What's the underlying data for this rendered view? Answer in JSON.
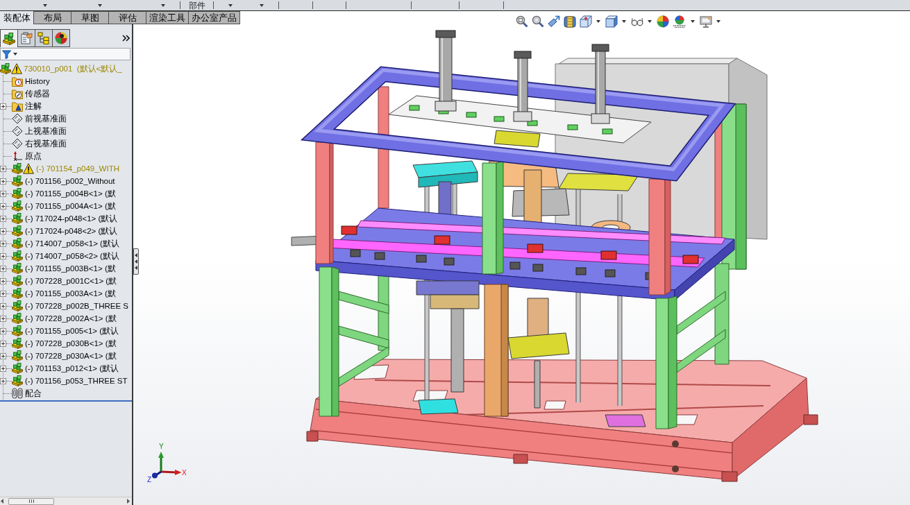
{
  "ribbon": {
    "group_label": "部件"
  },
  "command_tabs": [
    {
      "label": "装配体",
      "selected": true
    },
    {
      "label": "布局",
      "selected": false
    },
    {
      "label": "草图",
      "selected": false
    },
    {
      "label": "评估",
      "selected": false
    },
    {
      "label": "渲染工具",
      "selected": false
    },
    {
      "label": "办公室产品",
      "selected": false
    }
  ],
  "panel_tabs": [
    {
      "kind": "feature-tree",
      "selected": true
    },
    {
      "kind": "property-manager",
      "selected": false
    },
    {
      "kind": "configuration-manager",
      "selected": false
    },
    {
      "kind": "display-manager",
      "selected": false
    }
  ],
  "feature_tree": [
    {
      "label": "730010_p001  (默认<默认_",
      "kind": "assembly",
      "warning": true,
      "children": [
        {
          "label": "History",
          "kind": "history",
          "warning": false
        },
        {
          "label": "传感器",
          "kind": "sensors",
          "warning": false
        },
        {
          "label": "注解",
          "kind": "annotations",
          "warning": false,
          "expanded": false
        },
        {
          "label": "前视基准面",
          "kind": "plane",
          "warning": false
        },
        {
          "label": "上视基准面",
          "kind": "plane",
          "warning": false
        },
        {
          "label": "右视基准面",
          "kind": "plane",
          "warning": false
        },
        {
          "label": "原点",
          "kind": "origin",
          "warning": false
        },
        {
          "label": "(-) 701154_p049_WITH",
          "kind": "assembly",
          "warning": true,
          "expanded": false
        },
        {
          "label": "(-) 701156_p002_Without",
          "kind": "assembly",
          "warning": false,
          "expanded": false
        },
        {
          "label": "(-) 701155_p004B<1> (默",
          "kind": "assembly",
          "warning": false,
          "expanded": false
        },
        {
          "label": "(-) 701155_p004A<1> (默",
          "kind": "assembly",
          "warning": false,
          "expanded": false
        },
        {
          "label": "(-) 717024-p048<1> (默认",
          "kind": "assembly",
          "warning": false,
          "expanded": false
        },
        {
          "label": "(-) 717024-p048<2> (默认",
          "kind": "assembly",
          "warning": false,
          "expanded": false
        },
        {
          "label": "(-) 714007_p058<1> (默认",
          "kind": "assembly",
          "warning": false,
          "expanded": false
        },
        {
          "label": "(-) 714007_p058<2> (默认",
          "kind": "assembly",
          "warning": false,
          "expanded": false
        },
        {
          "label": "(-) 701155_p003B<1> (默",
          "kind": "assembly",
          "warning": false,
          "expanded": false
        },
        {
          "label": "(-) 707228_p001C<1> (默",
          "kind": "assembly",
          "warning": false,
          "expanded": false
        },
        {
          "label": "(-) 701155_p003A<1> (默",
          "kind": "assembly",
          "warning": false,
          "expanded": false
        },
        {
          "label": "(-) 707228_p002B_THREE S",
          "kind": "assembly",
          "warning": false,
          "expanded": false
        },
        {
          "label": "(-) 707228_p002A<1> (默",
          "kind": "assembly",
          "warning": false,
          "expanded": false
        },
        {
          "label": "(-) 701155_p005<1> (默认",
          "kind": "assembly",
          "warning": false,
          "expanded": false
        },
        {
          "label": "(-) 707228_p030B<1> (默",
          "kind": "assembly",
          "warning": false,
          "expanded": false
        },
        {
          "label": "(-) 707228_p030A<1> (默",
          "kind": "assembly",
          "warning": false,
          "expanded": false
        },
        {
          "label": "(-) 701153_p012<1> (默认",
          "kind": "assembly",
          "warning": false,
          "expanded": false
        },
        {
          "label": "(-) 701156_p053_THREE ST",
          "kind": "assembly",
          "warning": false,
          "expanded": false
        },
        {
          "label": "配合",
          "kind": "mates",
          "warning": false
        }
      ]
    }
  ],
  "view_toolbar": [
    {
      "kind": "zoom-fit",
      "dropdown": false
    },
    {
      "kind": "zoom-area",
      "dropdown": false
    },
    {
      "kind": "previous-view",
      "dropdown": false
    },
    {
      "kind": "section-view",
      "dropdown": false
    },
    {
      "kind": "view-orientation",
      "dropdown": true
    },
    {
      "kind": "display-style",
      "dropdown": true
    },
    {
      "kind": "hide-show",
      "dropdown": true
    },
    {
      "kind": "appearance",
      "dropdown": false
    },
    {
      "kind": "scene",
      "dropdown": true
    },
    {
      "kind": "view-settings",
      "dropdown": true
    }
  ],
  "triad": {
    "x": "X",
    "y": "Y",
    "z": "Z"
  }
}
